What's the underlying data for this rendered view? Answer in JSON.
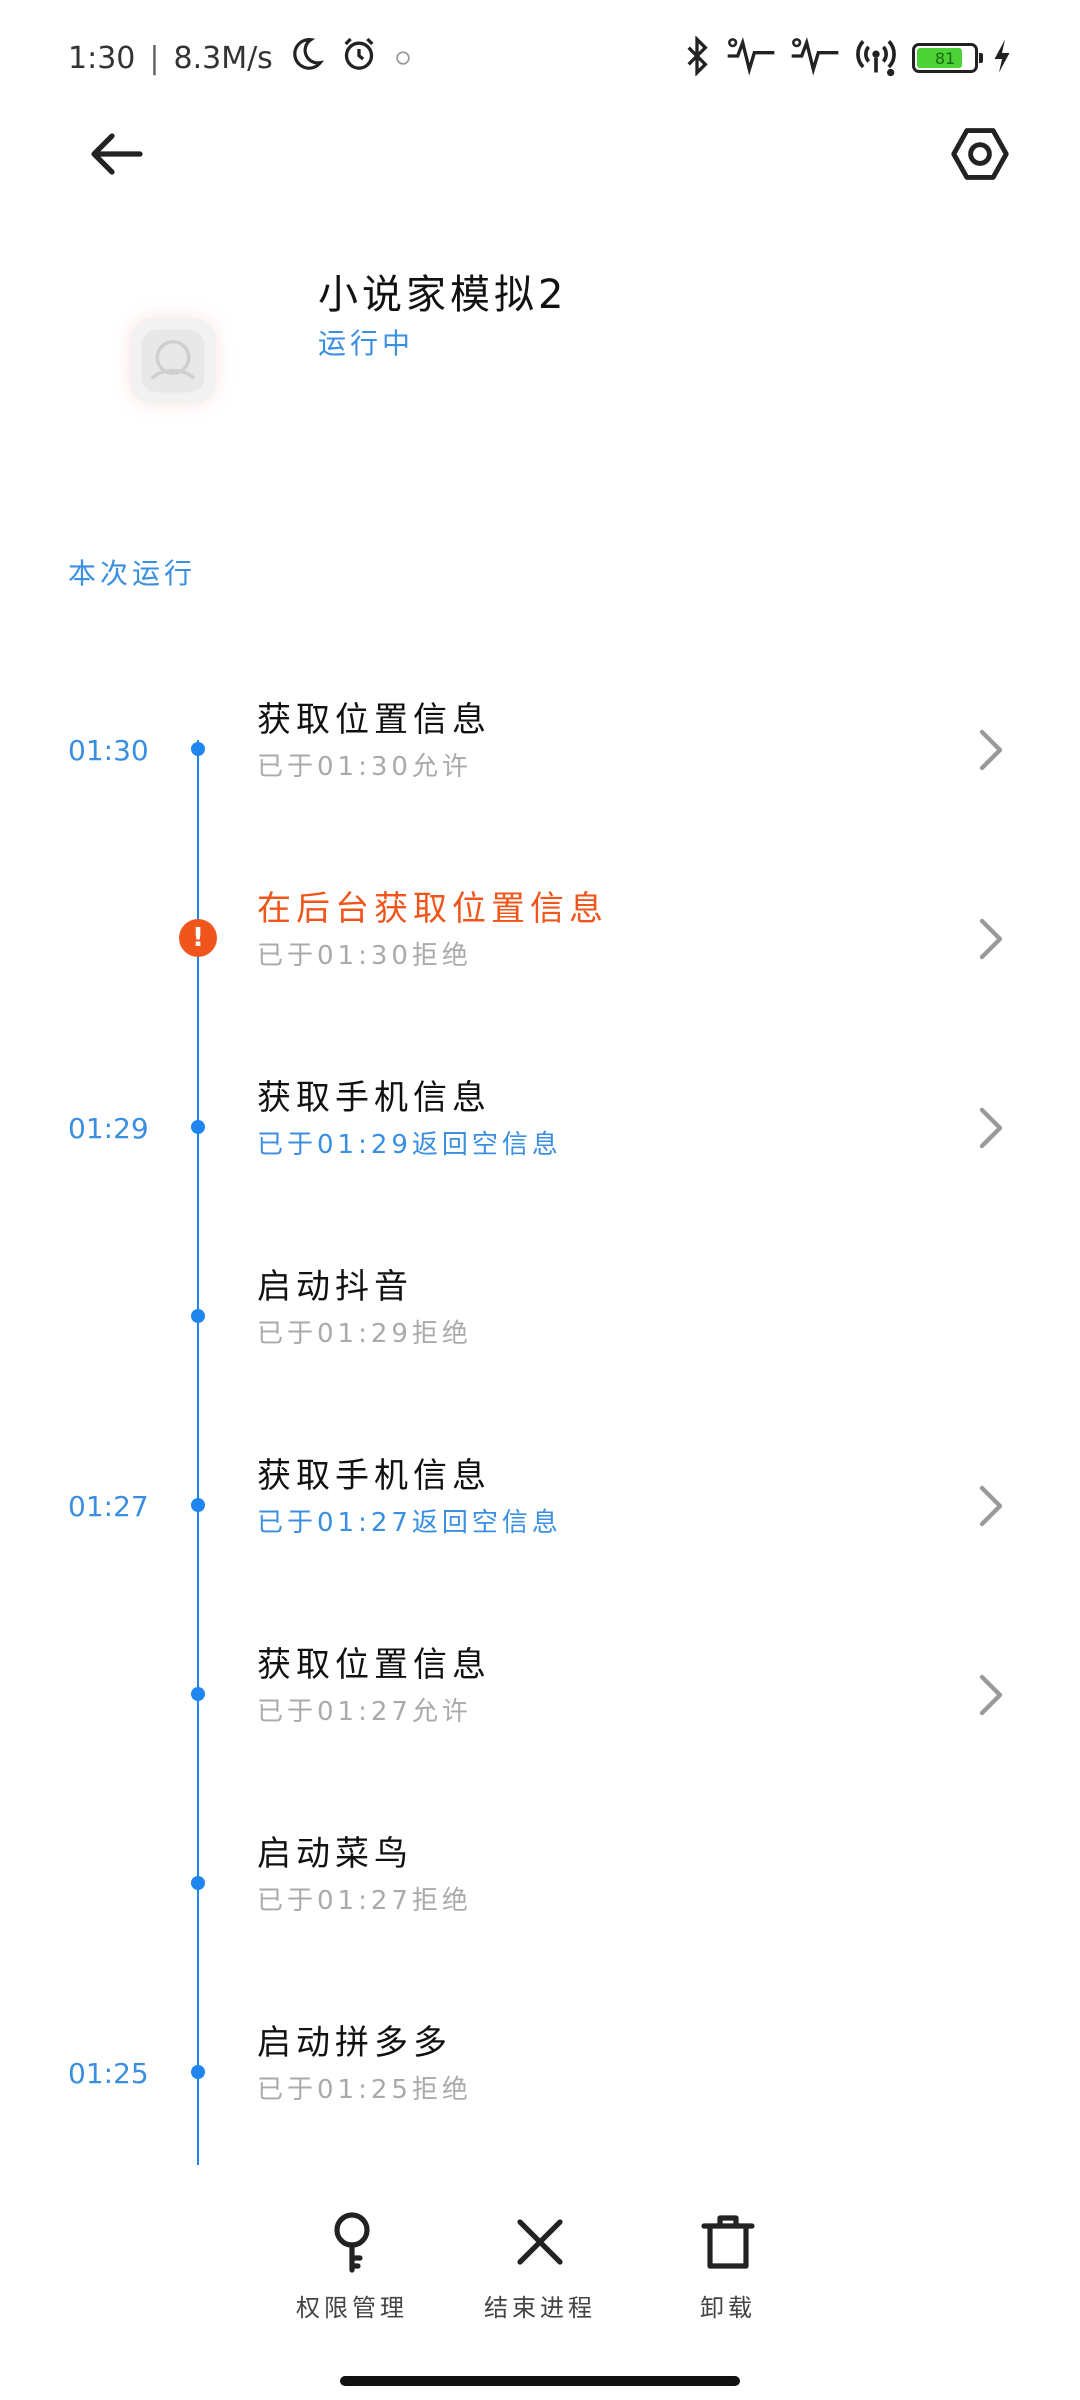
{
  "status_bar": {
    "time": "1:30",
    "net_speed": "8.3M/s",
    "battery_level": 0.81,
    "battery_text": "81",
    "battery_color": "#4cd137"
  },
  "header": {
    "back_icon": "arrow-left-icon",
    "settings_icon": "hexagon-settings-icon"
  },
  "app": {
    "name": "小说家模拟2",
    "status": "运行中"
  },
  "section_title": "本次运行",
  "timeline": [
    {
      "time": "01:30",
      "title": "获取位置信息",
      "sub": "已于01:30允许",
      "marker": "dot",
      "title_style": "normal",
      "sub_style": "muted",
      "chevron": true
    },
    {
      "time": "",
      "title": "在后台获取位置信息",
      "sub": "已于01:30拒绝",
      "marker": "alert",
      "title_style": "warn",
      "sub_style": "muted",
      "chevron": true
    },
    {
      "time": "01:29",
      "title": "获取手机信息",
      "sub": "已于01:29返回空信息",
      "marker": "dot",
      "title_style": "normal",
      "sub_style": "info",
      "chevron": true
    },
    {
      "time": "",
      "title": "启动抖音",
      "sub": "已于01:29拒绝",
      "marker": "dot",
      "title_style": "normal",
      "sub_style": "muted",
      "chevron": false
    },
    {
      "time": "01:27",
      "title": "获取手机信息",
      "sub": "已于01:27返回空信息",
      "marker": "dot",
      "title_style": "normal",
      "sub_style": "info",
      "chevron": true
    },
    {
      "time": "",
      "title": "获取位置信息",
      "sub": "已于01:27允许",
      "marker": "dot",
      "title_style": "normal",
      "sub_style": "muted",
      "chevron": true
    },
    {
      "time": "",
      "title": "启动菜鸟",
      "sub": "已于01:27拒绝",
      "marker": "dot",
      "title_style": "normal",
      "sub_style": "muted",
      "chevron": false
    },
    {
      "time": "01:25",
      "title": "启动拼多多",
      "sub": "已于01:25拒绝",
      "marker": "dot",
      "title_style": "normal",
      "sub_style": "muted",
      "chevron": false
    }
  ],
  "actions": [
    {
      "label": "权限管理",
      "icon": "key-icon"
    },
    {
      "label": "结束进程",
      "icon": "close-icon"
    },
    {
      "label": "卸载",
      "icon": "trash-icon"
    }
  ],
  "colors": {
    "accent": "#1f86f0",
    "info_text": "#3b8fe0",
    "warning": "#f0561c",
    "muted": "#aaaaaa"
  }
}
